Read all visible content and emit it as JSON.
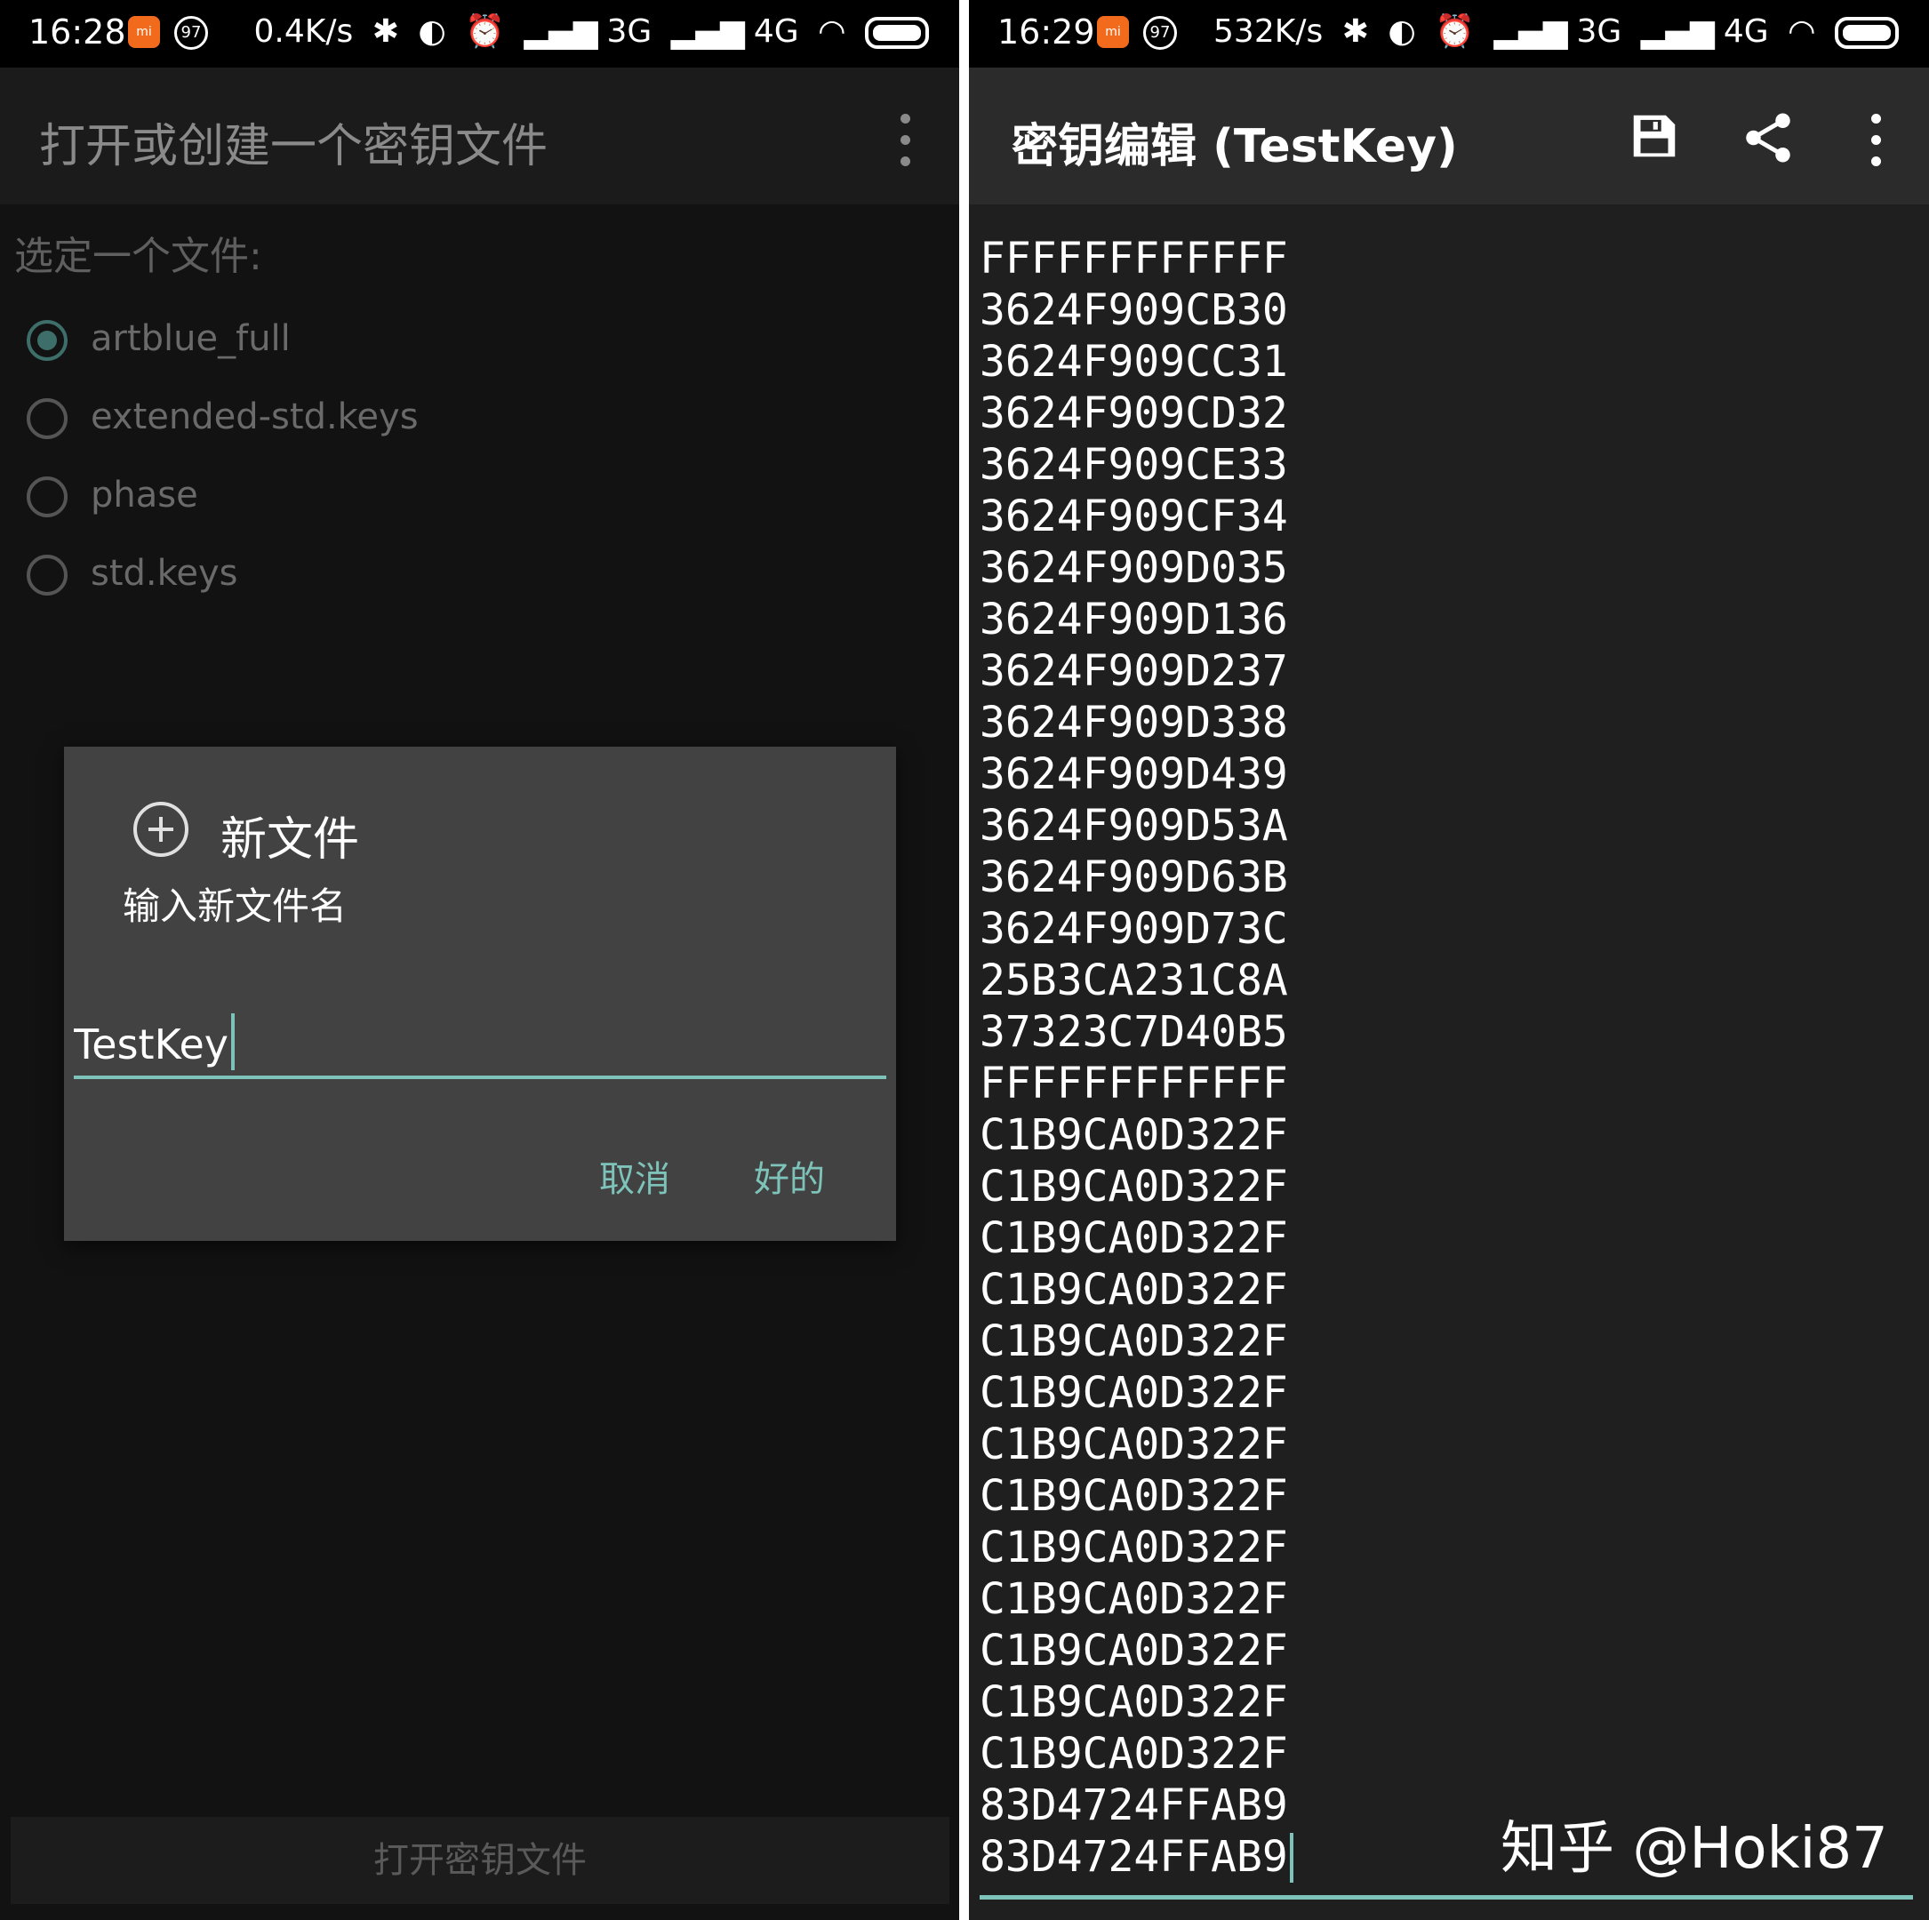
{
  "left_screen": {
    "status_bar": {
      "time": "16:28",
      "app_badge": "mi",
      "badge_number": "97",
      "net_speed": "0.4K/s",
      "network_3g": "3G",
      "network_4g": "4G"
    },
    "app_bar": {
      "title": "打开或创建一个密钥文件"
    },
    "file_section": {
      "label": "选定一个文件:",
      "files": [
        {
          "name": "artblue_full",
          "selected": true
        },
        {
          "name": "extended-std.keys",
          "selected": false
        },
        {
          "name": "phase",
          "selected": false
        },
        {
          "name": "std.keys",
          "selected": false
        }
      ]
    },
    "dialog": {
      "title": "新文件",
      "message": "输入新文件名",
      "input_value": "TestKey",
      "cancel_label": "取消",
      "ok_label": "好的"
    },
    "bottom_button": "打开密钥文件"
  },
  "right_screen": {
    "status_bar": {
      "time": "16:29",
      "app_badge": "mi",
      "badge_number": "97",
      "net_speed": "532K/s",
      "network_3g": "3G",
      "network_4g": "4G"
    },
    "app_bar": {
      "title": "密钥编辑 (TestKey)"
    },
    "editor_lines": [
      "FFFFFFFFFFFF",
      "3624F909CB30",
      "3624F909CC31",
      "3624F909CD32",
      "3624F909CE33",
      "3624F909CF34",
      "3624F909D035",
      "3624F909D136",
      "3624F909D237",
      "3624F909D338",
      "3624F909D439",
      "3624F909D53A",
      "3624F909D63B",
      "3624F909D73C",
      "25B3CA231C8A",
      "37323C7D40B5",
      "FFFFFFFFFFFF",
      "C1B9CA0D322F",
      "C1B9CA0D322F",
      "C1B9CA0D322F",
      "C1B9CA0D322F",
      "C1B9CA0D322F",
      "C1B9CA0D322F",
      "C1B9CA0D322F",
      "C1B9CA0D322F",
      "C1B9CA0D322F",
      "C1B9CA0D322F",
      "C1B9CA0D322F",
      "C1B9CA0D322F",
      "C1B9CA0D322F",
      "83D4724FFAB9",
      "83D4724FFAB9"
    ],
    "watermark": "知乎 @Hoki87"
  },
  "icons": [
    "kebab-menu-icon",
    "add-circle-icon",
    "save-icon",
    "share-icon",
    "bluetooth-icon",
    "alarm-icon",
    "wifi-icon",
    "battery-icon"
  ],
  "colors": {
    "accent": "#7ec3b9",
    "dialog_bg": "#424242",
    "app_icon": "#f26b1d"
  }
}
